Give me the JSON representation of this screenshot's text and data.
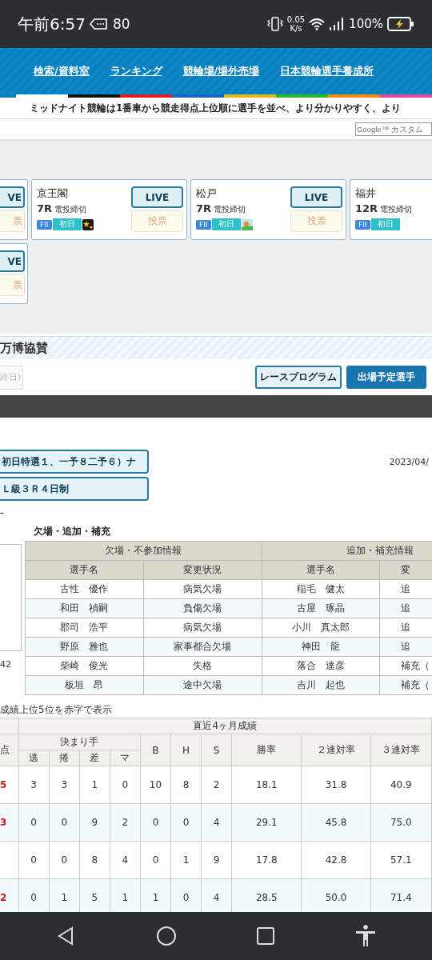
{
  "status_bar": {
    "time": "午前6:57",
    "notification_count": "80",
    "net_speed": "0.05",
    "net_unit": "K/s",
    "battery": "100%"
  },
  "nav": {
    "links": [
      "検索/資料室",
      "ランキング",
      "競輪場/場外売場",
      "日本競輪選手養成所"
    ]
  },
  "marquee": "ミッドナイト競輪は1番車から競走得点上位順に選手を並べ、より分かりやすく、より",
  "search": {
    "placeholder": "Google™ カスタム"
  },
  "card_rows": [
    [
      {
        "kind": "partial",
        "live": "VE",
        "vote": "票",
        "vote_disabled": true
      },
      {
        "kind": "full",
        "venue": "京王閣",
        "race": "7R",
        "status": "電投締切",
        "badges": [
          {
            "kind": "grade",
            "text": "FII"
          },
          {
            "kind": "day",
            "text": "初日"
          },
          {
            "kind": "night"
          }
        ],
        "live": "LIVE",
        "vote": "投票",
        "vote_disabled": true
      },
      {
        "kind": "full",
        "venue": "松戸",
        "race": "7R",
        "status": "電投締切",
        "badges": [
          {
            "kind": "grade",
            "text": "FII"
          },
          {
            "kind": "day",
            "text": "初日"
          },
          {
            "kind": "morning"
          }
        ],
        "live": "LIVE",
        "vote": "投票",
        "vote_disabled": true
      },
      {
        "kind": "cut",
        "venue": "福井",
        "race": "12R",
        "status": "電投締切",
        "badges": [
          {
            "kind": "grade",
            "text": "FII"
          },
          {
            "kind": "day",
            "text": "初日"
          }
        ]
      }
    ],
    [
      {
        "kind": "partial",
        "live": "VE",
        "vote": "票",
        "vote_disabled": true
      }
    ]
  ],
  "section_title": "万博協賛",
  "schedule_button": {
    "label": "終日)",
    "disabled": true
  },
  "tabs": [
    {
      "label": "レースプログラム",
      "selected": false
    },
    {
      "label": "出場予定選手",
      "selected": true
    }
  ],
  "race_info": {
    "series": "初日特選１、一予８二予６）ナ",
    "date": "2023/04/",
    "grade_info": "Ｌ級３Ｒ４日制",
    "dash": "-",
    "side_number": "42"
  },
  "changes": {
    "title": "欠場・追加・補充",
    "groups": [
      "欠場・不参加情報",
      "追加・補充情報"
    ],
    "columns": [
      "選手名",
      "変更状況",
      "選手名",
      "変"
    ],
    "rows": [
      [
        "古性　優作",
        "病気欠場",
        "稲毛　健太",
        "追"
      ],
      [
        "和田　禎嗣",
        "負傷欠場",
        "古屋　琢晶",
        "追"
      ],
      [
        "郡司　浩平",
        "病気欠場",
        "小川　真太郎",
        "追"
      ],
      [
        "野原　雅也",
        "家事都合欠場",
        "神田　龍",
        "追"
      ],
      [
        "柴崎　俊光",
        "失格",
        "落合　達彦",
        "補充（"
      ],
      [
        "板垣　昂",
        "途中欠場",
        "吉川　起也",
        "補充（"
      ]
    ]
  },
  "note": "成績上位5位を赤字で表示",
  "results": {
    "title": "直近4ヶ月成績",
    "score_header": "点",
    "technique_header": "決まり手",
    "technique_columns": [
      "逃",
      "捲",
      "差",
      "マ"
    ],
    "columns": [
      "B",
      "H",
      "S",
      "勝率",
      "２連対率",
      "３連対率"
    ],
    "rows": [
      {
        "score": "5",
        "top": true,
        "values": [
          "3",
          "3",
          "1",
          "0",
          "10",
          "8",
          "2",
          "18.1",
          "31.8",
          "40.9"
        ]
      },
      {
        "score": "3",
        "top": true,
        "values": [
          "0",
          "0",
          "9",
          "2",
          "0",
          "0",
          "4",
          "29.1",
          "45.8",
          "75.0"
        ]
      },
      {
        "values": [
          "0",
          "0",
          "8",
          "4",
          "0",
          "1",
          "9",
          "17.8",
          "42.8",
          "57.1"
        ]
      },
      {
        "score": "2",
        "top": true,
        "values": [
          "0",
          "1",
          "5",
          "1",
          "1",
          "0",
          "4",
          "28.5",
          "50.0",
          "71.4"
        ]
      }
    ]
  }
}
